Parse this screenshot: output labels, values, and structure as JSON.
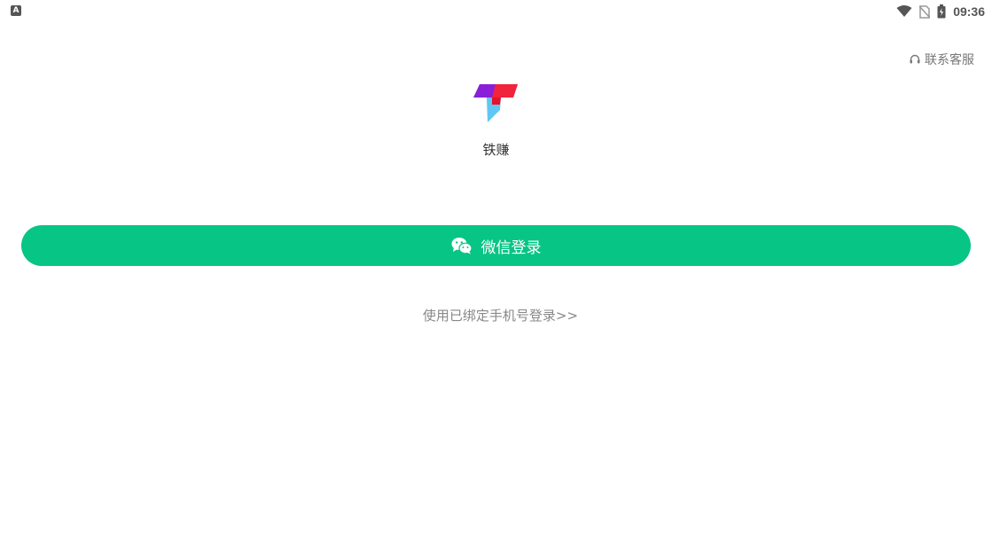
{
  "status_bar": {
    "left_icon": "A",
    "time": "09:36",
    "icons": [
      "wifi-icon",
      "no-sim-icon",
      "battery-icon"
    ]
  },
  "header": {
    "support_label": "联系客服",
    "support_icon": "headset-icon"
  },
  "app": {
    "name": "铁赚",
    "logo": "app-logo"
  },
  "login": {
    "wechat_label": "微信登录",
    "wechat_icon": "wechat-icon",
    "phone_login_label": "使用已绑定手机号登录>>"
  },
  "colors": {
    "primary_green": "#07c585",
    "text_gray": "#888888"
  }
}
